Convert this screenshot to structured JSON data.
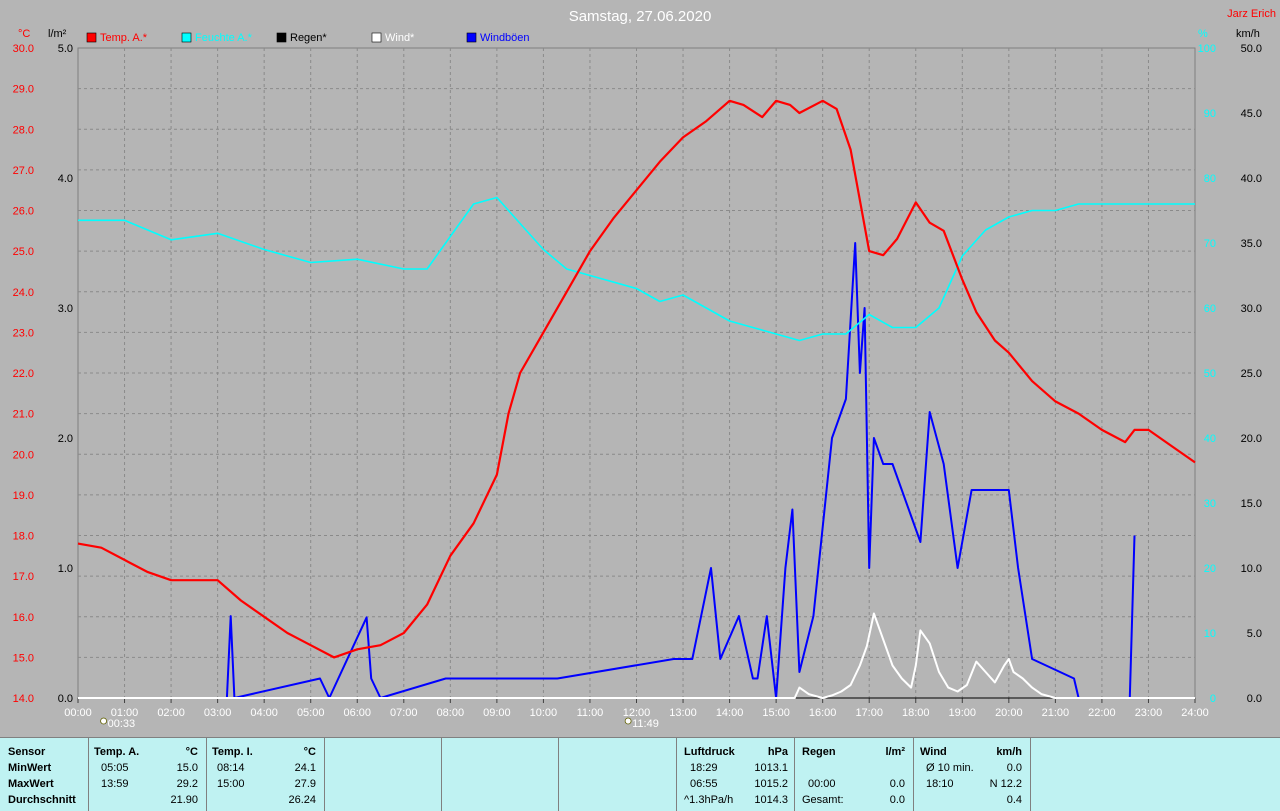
{
  "chart_data": {
    "type": "line",
    "title": "Samstag, 27.06.2020",
    "author": "Jarz Erich",
    "x_ticks": [
      "00:00",
      "01:00",
      "02:00",
      "03:00",
      "04:00",
      "05:00",
      "06:00",
      "07:00",
      "08:00",
      "09:00",
      "10:00",
      "11:00",
      "12:00",
      "13:00",
      "14:00",
      "15:00",
      "16:00",
      "17:00",
      "18:00",
      "19:00",
      "20:00",
      "21:00",
      "22:00",
      "23:00",
      "24:00"
    ],
    "axes": {
      "temp": {
        "unit": "°C",
        "ylim": [
          14.0,
          30.0
        ],
        "ticks": [
          "14.0",
          "15.0",
          "16.0",
          "17.0",
          "18.0",
          "19.0",
          "20.0",
          "21.0",
          "22.0",
          "23.0",
          "24.0",
          "25.0",
          "26.0",
          "27.0",
          "28.0",
          "29.0",
          "30.0"
        ],
        "color": "#ff0000"
      },
      "rain": {
        "unit": "l/m²",
        "ylim": [
          0.0,
          5.0
        ],
        "ticks": [
          "0.0",
          "1.0",
          "2.0",
          "3.0",
          "4.0",
          "5.0"
        ],
        "color": "#000000"
      },
      "humidity": {
        "unit": "%",
        "ylim": [
          0,
          100
        ],
        "ticks": [
          "0",
          "10",
          "20",
          "30",
          "40",
          "50",
          "60",
          "70",
          "80",
          "90",
          "100"
        ],
        "color": "#00ffff"
      },
      "wind": {
        "unit": "km/h",
        "ylim": [
          0.0,
          50.0
        ],
        "ticks": [
          "0.0",
          "5.0",
          "10.0",
          "15.0",
          "20.0",
          "25.0",
          "30.0",
          "35.0",
          "40.0",
          "45.0",
          "50.0"
        ],
        "color": "#000000"
      }
    },
    "legend": [
      {
        "name": "Temp. A.*",
        "color": "#ff0000"
      },
      {
        "name": "Feuchte A.*",
        "color": "#00ffff"
      },
      {
        "name": "Regen*",
        "color": "#000000"
      },
      {
        "name": "Wind*",
        "color": "#ffffff"
      },
      {
        "name": "Windböen",
        "color": "#0000ff"
      }
    ],
    "markers": [
      {
        "label": "00:33",
        "x": 0.55,
        "icon": "sunrise-icon"
      },
      {
        "label": "11:49",
        "x": 11.82,
        "icon": "sun-icon"
      }
    ],
    "grid": true,
    "series": [
      {
        "name": "Temp. A.*",
        "axis": "temp",
        "color": "#ff0000",
        "x": [
          0,
          0.5,
          1,
          1.5,
          2,
          2.5,
          3,
          3.5,
          4,
          4.5,
          5,
          5.5,
          6,
          6.5,
          7,
          7.5,
          8,
          8.5,
          9,
          9.25,
          9.5,
          10,
          10.5,
          11,
          11.5,
          12,
          12.5,
          13,
          13.5,
          14,
          14.3,
          14.7,
          15,
          15.3,
          15.5,
          16,
          16.3,
          16.6,
          17,
          17.3,
          17.6,
          18,
          18.3,
          18.6,
          19,
          19.3,
          19.7,
          20,
          20.5,
          21,
          21.5,
          22,
          22.5,
          22.7,
          23,
          23.5,
          24
        ],
        "y": [
          17.8,
          17.7,
          17.4,
          17.1,
          16.9,
          16.9,
          16.9,
          16.4,
          16.0,
          15.6,
          15.3,
          15.0,
          15.2,
          15.3,
          15.6,
          16.3,
          17.5,
          18.3,
          19.5,
          21.0,
          22.0,
          23.0,
          24.0,
          25.0,
          25.8,
          26.5,
          27.2,
          27.8,
          28.2,
          28.7,
          28.6,
          28.3,
          28.7,
          28.6,
          28.4,
          28.7,
          28.5,
          27.5,
          25.0,
          24.9,
          25.3,
          26.2,
          25.7,
          25.5,
          24.3,
          23.5,
          22.8,
          22.5,
          21.8,
          21.3,
          21.0,
          20.6,
          20.3,
          20.6,
          20.6,
          20.2,
          19.8
        ]
      },
      {
        "name": "Feuchte A.*",
        "axis": "humidity",
        "color": "#00ffff",
        "x": [
          0,
          1,
          2,
          3,
          4,
          5,
          6,
          7,
          7.5,
          8,
          8.5,
          9,
          9.5,
          10,
          10.5,
          11,
          12,
          12.5,
          13,
          13.5,
          14,
          14.5,
          15,
          15.5,
          16,
          16.5,
          17,
          17.5,
          18,
          18.5,
          19,
          19.5,
          20,
          20.5,
          21,
          21.5,
          22,
          22.5,
          23,
          23.5,
          24
        ],
        "y": [
          73.5,
          73.5,
          70.5,
          71.5,
          69,
          67,
          67.5,
          66,
          66,
          71,
          76,
          77,
          73,
          69,
          66,
          65,
          63,
          61,
          62,
          60,
          58,
          57,
          56,
          55,
          56,
          56,
          59,
          57,
          57,
          60,
          68,
          72,
          74,
          75,
          75,
          76,
          76,
          76,
          76,
          76,
          76
        ]
      },
      {
        "name": "Windböen",
        "axis": "wind",
        "color": "#0000ff",
        "x": [
          3.2,
          3.28,
          3.36,
          5.2,
          5.4,
          6.2,
          6.3,
          6.5,
          7.9,
          8.3,
          9.0,
          9.4,
          9.8,
          10.0,
          10.3,
          12.8,
          13.2,
          13.6,
          13.8,
          14.2,
          14.5,
          14.6,
          14.8,
          15.0,
          15.2,
          15.35,
          15.5,
          15.8,
          16.2,
          16.5,
          16.7,
          16.8,
          16.9,
          17.0,
          17.1,
          17.3,
          17.5,
          17.7,
          17.9,
          18.1,
          18.3,
          18.6,
          18.9,
          19.2,
          19.35,
          19.6,
          19.85,
          20.0,
          20.2,
          20.5,
          21.4,
          21.5,
          22.6,
          22.7
        ],
        "y": [
          0,
          6.3,
          0,
          1.5,
          0,
          6.2,
          1.5,
          0,
          1.5,
          1.5,
          1.5,
          1.5,
          1.5,
          1.5,
          1.5,
          3,
          3,
          10,
          3,
          6.3,
          1.5,
          1.5,
          6.3,
          0,
          10,
          14.5,
          2,
          6.3,
          20,
          23,
          35,
          25,
          30,
          10,
          20,
          18,
          18,
          16,
          14,
          12,
          22,
          18,
          10,
          16,
          16,
          16,
          16,
          16,
          10,
          3,
          1.5,
          0,
          0,
          12.5
        ]
      },
      {
        "name": "Wind*",
        "axis": "wind",
        "color": "#ffffff",
        "x": [
          0,
          15.4,
          15.5,
          15.7,
          16,
          16.2,
          16.4,
          16.6,
          16.8,
          16.95,
          17.1,
          17.3,
          17.5,
          17.7,
          17.9,
          18.0,
          18.1,
          18.3,
          18.5,
          18.7,
          18.9,
          19.1,
          19.3,
          19.5,
          19.7,
          19.9,
          20.0,
          20.1,
          20.3,
          20.5,
          20.7,
          21,
          24
        ],
        "y": [
          0,
          0,
          0.8,
          0.3,
          0,
          0.2,
          0.5,
          1.0,
          2.5,
          4.0,
          6.5,
          4.5,
          2.5,
          1.5,
          0.8,
          2.5,
          5.2,
          4.2,
          2.0,
          0.8,
          0.5,
          1.0,
          2.8,
          2.0,
          1.2,
          2.5,
          3.0,
          2.0,
          1.5,
          0.8,
          0.3,
          0,
          0
        ]
      },
      {
        "name": "Regen*",
        "axis": "rain",
        "color": "#000000",
        "x": [
          0,
          24
        ],
        "y": [
          0,
          0
        ]
      }
    ]
  },
  "table": {
    "col1": {
      "header": "Sensor",
      "row1": "MinWert",
      "row2": "MaxWert",
      "row3": "Durchschnitt"
    },
    "col2": {
      "header": "Temp. A.",
      "unit": "°C",
      "min_time": "05:05",
      "min_val": "15.0",
      "max_time": "13:59",
      "max_val": "29.2",
      "avg": "21.90"
    },
    "col3": {
      "header": "Temp. I.",
      "unit": "°C",
      "min_time": "08:14",
      "min_val": "24.1",
      "max_time": "15:00",
      "max_val": "27.9",
      "avg": "26.24"
    },
    "col4": {
      "header": "Luftdruck",
      "unit": "hPa",
      "min_time": "18:29",
      "min_val": "1013.1",
      "max_time": "06:55",
      "max_val": "1015.2",
      "trend": "^1.3hPa/h",
      "trend_val": "1014.3"
    },
    "col5": {
      "header": "Regen",
      "unit": "l/m²",
      "r2_time": "00:00",
      "r2_val": "0.0",
      "r3_label": "Gesamt:",
      "r3_val": "0.0"
    },
    "col6": {
      "header": "Wind",
      "unit": "km/h",
      "r1_label": "Ø 10 min.",
      "r1_val": "0.0",
      "r2_time": "18:10",
      "r2_val": "N 12.2",
      "r3_val": "0.4"
    }
  }
}
